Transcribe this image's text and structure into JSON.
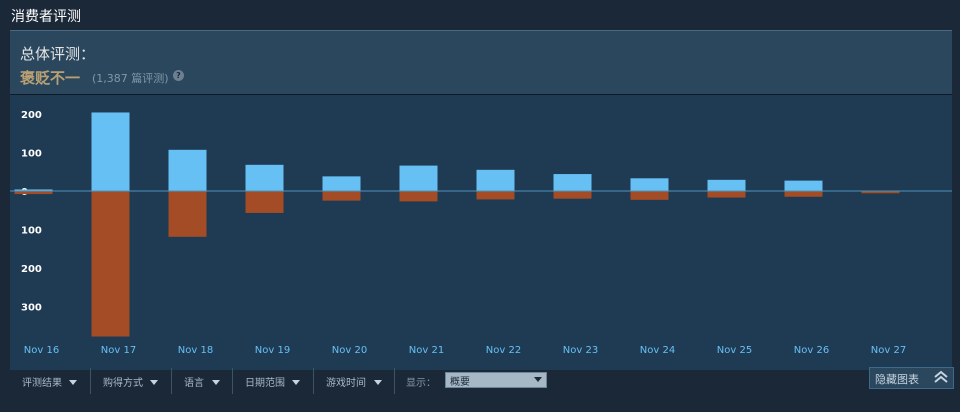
{
  "section": {
    "title": "消费者评测"
  },
  "summary": {
    "overall_label": "总体评测：",
    "verdict": "褒贬不一",
    "count": "(1,387 篇评测)",
    "help_symbol": "?"
  },
  "chart_data": {
    "type": "bar",
    "categories": [
      "Nov 16",
      "Nov 17",
      "Nov 18",
      "Nov 19",
      "Nov 20",
      "Nov 21",
      "Nov 22",
      "Nov 23",
      "Nov 24",
      "Nov 25",
      "Nov 26",
      "Nov 27"
    ],
    "series": [
      {
        "values": [
          4,
          204,
          107,
          68,
          38,
          66,
          55,
          44,
          33,
          29,
          27,
          1
        ],
        "color": "#66c0f4"
      },
      {
        "values": [
          -8,
          -378,
          -119,
          -57,
          -25,
          -27,
          -22,
          -20,
          -23,
          -17,
          -15,
          -6
        ],
        "color": "#a34c25"
      }
    ],
    "y_tick_labels": [
      "200",
      "100",
      "0",
      "100",
      "200",
      "300"
    ],
    "ylim": [
      -380,
      210
    ],
    "grid": false
  },
  "filters": [
    {
      "label": "评测结果"
    },
    {
      "label": "购得方式"
    },
    {
      "label": "语言"
    },
    {
      "label": "日期范围"
    },
    {
      "label": "游戏时间"
    }
  ],
  "display": {
    "label": "显示：",
    "value": "概要"
  },
  "hide_button": {
    "label": "隐藏图表"
  }
}
